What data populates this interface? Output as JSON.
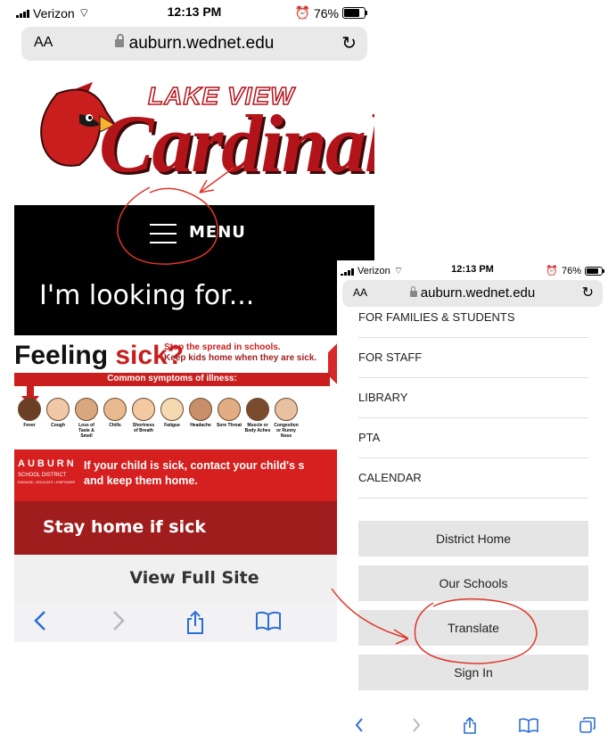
{
  "left": {
    "status": {
      "carrier": "Verizon",
      "time": "12:13 PM",
      "battery": "76%"
    },
    "browser": {
      "aa": "AA",
      "url": "auburn.wednet.edu",
      "reload": "↻"
    },
    "logo": {
      "tagline": "LAKE VIEW",
      "word": "Cardinals"
    },
    "menu": {
      "label": "MENU"
    },
    "looking": "I'm looking for...",
    "banner": {
      "headline_a": "Feeling ",
      "headline_b": "sick?",
      "stop_line1": "Stop the spread in schools.",
      "stop_line2": "Keep kids home when they are sick.",
      "symptoms_title": "Common symptoms of illness:",
      "symptoms": [
        "Fever",
        "Cough",
        "Loss of Taste & Smell",
        "Chills",
        "Shortness of Breath",
        "Fatigue",
        "Headache",
        "Sore Throat",
        "Muscle or Body Aches",
        "Congestion or Runny Nose"
      ],
      "district_name": "AUBURN",
      "district_sub": "SCHOOL DISTRICT",
      "district_motto": "ENGAGE • EDUCATE • EMPOWER",
      "contact_line1": "If your child is sick, contact your child's s",
      "contact_line2": "and keep them home."
    },
    "stay_home": "Stay home if sick",
    "full_site": "View Full Site",
    "toolbar_icons": [
      "back-icon",
      "forward-icon",
      "share-icon",
      "bookmarks-icon"
    ]
  },
  "right": {
    "status": {
      "carrier": "Verizon",
      "time": "12:13 PM",
      "battery": "76%"
    },
    "browser": {
      "aa": "AA",
      "url": "auburn.wednet.edu",
      "reload": "↻"
    },
    "nav_items": [
      "FOR FAMILIES & STUDENTS",
      "FOR STAFF",
      "LIBRARY",
      "PTA",
      "CALENDAR"
    ],
    "buttons": [
      "District Home",
      "Our Schools",
      "Translate",
      "Sign In"
    ],
    "toolbar_icons": [
      "back-icon",
      "forward-icon",
      "share-icon",
      "bookmarks-icon",
      "tabs-icon"
    ]
  },
  "colors": {
    "annotation": "#e0352a",
    "brand_red": "#c81e1e",
    "dark_red": "#a01d1d"
  }
}
